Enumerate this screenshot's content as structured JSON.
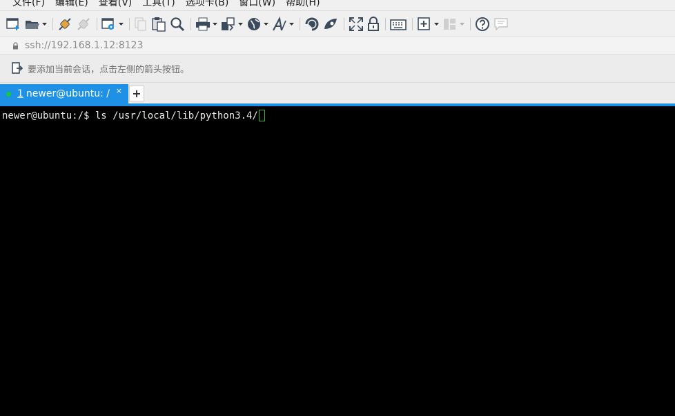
{
  "menu": [
    "文件(F)",
    "编辑(E)",
    "查看(V)",
    "工具(T)",
    "选项卡(B)",
    "窗口(W)",
    "帮助(H)"
  ],
  "toolbar": {
    "icons": [
      "new-session-icon",
      "open-folder-icon",
      "connect-icon",
      "disconnect-icon",
      "session-properties-icon",
      "copy-icon",
      "paste-icon",
      "find-icon",
      "print-icon",
      "transfer-icon",
      "globe-icon",
      "font-icon",
      "xftp-icon",
      "xshell-icon",
      "fullscreen-icon",
      "lock-icon",
      "keyboard-icon",
      "add-icon",
      "layout-icon",
      "help-icon",
      "chat-icon"
    ]
  },
  "address": {
    "url": "ssh://192.168.1.12:8123"
  },
  "hint": {
    "text": "要添加当前会话，点击左侧的箭头按钮。"
  },
  "tabs": [
    {
      "number": "1",
      "title": "newer@ubuntu: /",
      "close": "×",
      "status_color": "#16c93b"
    }
  ],
  "new_tab_label": "+",
  "terminal": {
    "prompt": "newer@ubuntu:/$ ",
    "command": "ls /usr/local/lib/python3.4/"
  },
  "colors": {
    "accent": "#1e90e6",
    "terminal_bg": "#000000",
    "cursor": "#17c740"
  }
}
